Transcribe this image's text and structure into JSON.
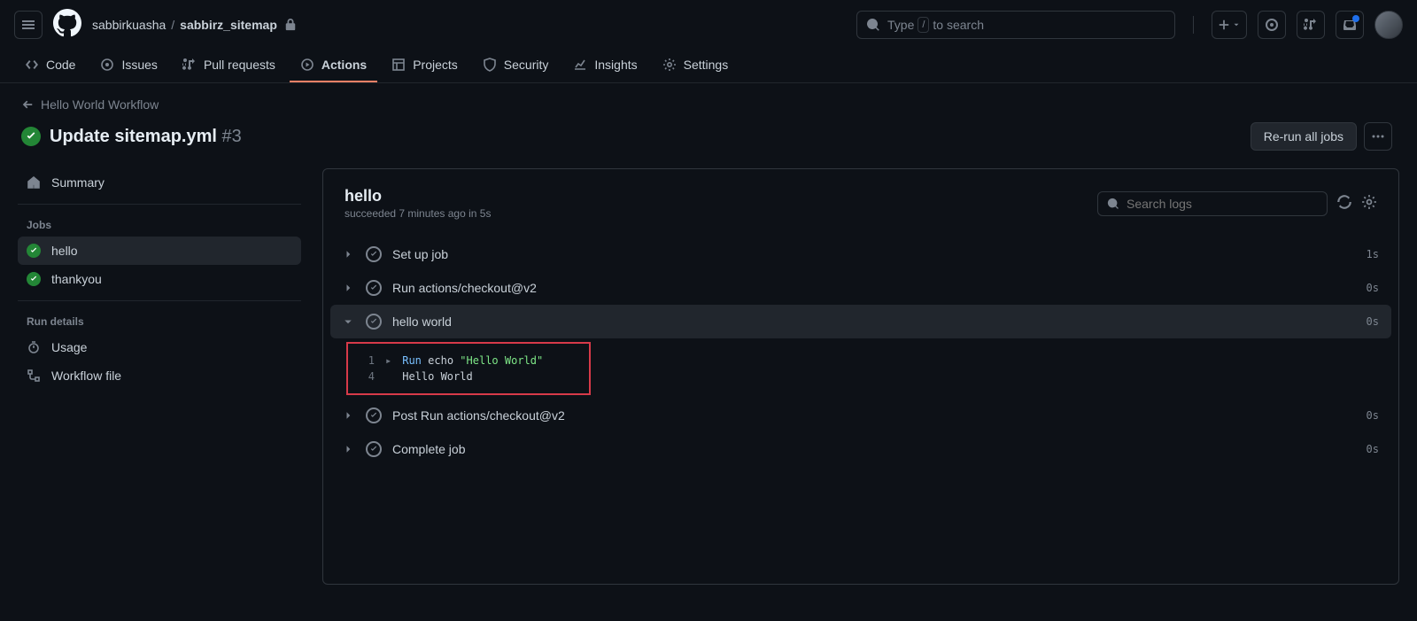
{
  "header": {
    "owner": "sabbirkuasha",
    "repo": "sabbirz_sitemap",
    "search_placeholder": "to search",
    "search_prefix": "Type",
    "search_key": "/"
  },
  "nav": {
    "code": "Code",
    "issues": "Issues",
    "pulls": "Pull requests",
    "actions": "Actions",
    "projects": "Projects",
    "security": "Security",
    "insights": "Insights",
    "settings": "Settings"
  },
  "run": {
    "back": "Hello World Workflow",
    "title": "Update sitemap.yml",
    "number": "#3",
    "rerun": "Re-run all jobs"
  },
  "sidebar": {
    "summary": "Summary",
    "jobs_heading": "Jobs",
    "jobs": [
      "hello",
      "thankyou"
    ],
    "details_heading": "Run details",
    "usage": "Usage",
    "workflow_file": "Workflow file"
  },
  "log": {
    "title": "hello",
    "subtitle": "succeeded 7 minutes ago in 5s",
    "search_placeholder": "Search logs",
    "steps": [
      {
        "name": "Set up job",
        "duration": "1s",
        "expanded": false
      },
      {
        "name": "Run actions/checkout@v2",
        "duration": "0s",
        "expanded": false
      },
      {
        "name": "hello world",
        "duration": "0s",
        "expanded": true
      },
      {
        "name": "Post Run actions/checkout@v2",
        "duration": "0s",
        "expanded": false
      },
      {
        "name": "Complete job",
        "duration": "0s",
        "expanded": false
      }
    ],
    "lines": [
      {
        "n": "1",
        "cmd_kw": "Run",
        "cmd_rest": "echo",
        "cmd_str": "\"Hello World\""
      },
      {
        "n": "4",
        "text": "Hello World"
      }
    ]
  }
}
